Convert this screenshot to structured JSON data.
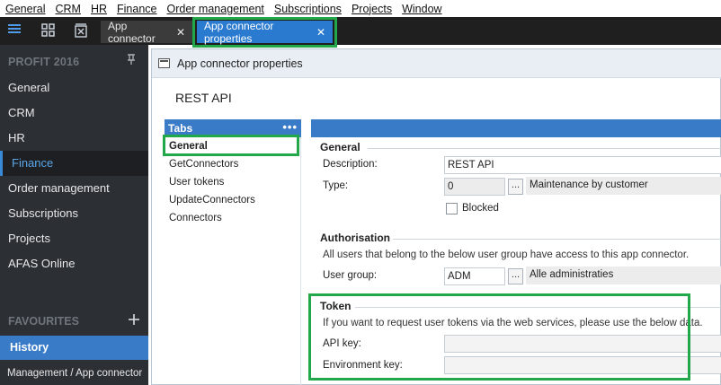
{
  "menu": [
    {
      "label": "General"
    },
    {
      "label": "CRM"
    },
    {
      "label": "HR"
    },
    {
      "label": "Finance"
    },
    {
      "label": "Order management"
    },
    {
      "label": "Subscriptions"
    },
    {
      "label": "Projects"
    },
    {
      "label": "Window"
    }
  ],
  "tabs": {
    "inactive_label": "App connector",
    "active_label": "App connector properties",
    "close_glyph": "✕"
  },
  "sidebar": {
    "header": "PROFIT 2016",
    "items": [
      {
        "label": "General"
      },
      {
        "label": "CRM"
      },
      {
        "label": "HR"
      },
      {
        "label": "Finance",
        "selected": true
      },
      {
        "label": "Order management"
      },
      {
        "label": "Subscriptions"
      },
      {
        "label": "Projects"
      },
      {
        "label": "AFAS Online"
      }
    ],
    "favourites": "FAVOURITES",
    "history": "History",
    "breadcrumb": "Management / App connector"
  },
  "window": {
    "title": "App connector properties",
    "heading": "REST API",
    "tabs_header": "Tabs",
    "tabs_menu_glyph": "•••",
    "tabs": [
      {
        "label": "General",
        "selected": true
      },
      {
        "label": "GetConnectors"
      },
      {
        "label": "User tokens"
      },
      {
        "label": "UpdateConnectors"
      },
      {
        "label": "Connectors"
      }
    ]
  },
  "general": {
    "title": "General",
    "description_label": "Description:",
    "description_value": "REST API",
    "type_label": "Type:",
    "type_value": "0",
    "type_text": "Maintenance by customer",
    "blocked_label": "Blocked",
    "blocked": false
  },
  "authorisation": {
    "title": "Authorisation",
    "note": "All users that belong to the below user group have access to this app connector.",
    "user_group_label": "User group:",
    "user_group_value": "ADM",
    "user_group_text": "Alle administraties"
  },
  "token": {
    "title": "Token",
    "note": "If you want to request user tokens via the web services, please use the below data.",
    "api_key_label": "API key:",
    "api_key_value": "",
    "env_key_label": "Environment key:",
    "env_key_value": ""
  },
  "lookup_button_glyph": "...",
  "icons": [
    "hamburger-menu-icon",
    "dashboard-grid-icon",
    "close-all-icon",
    "pin-icon",
    "add-favourite-icon",
    "window-icon"
  ],
  "colors": {
    "accent": "#3a7bc8",
    "active_tab": "#2a7ad0",
    "highlight_box": "#22a84a",
    "sidebar_bg": "#2c2f33"
  }
}
